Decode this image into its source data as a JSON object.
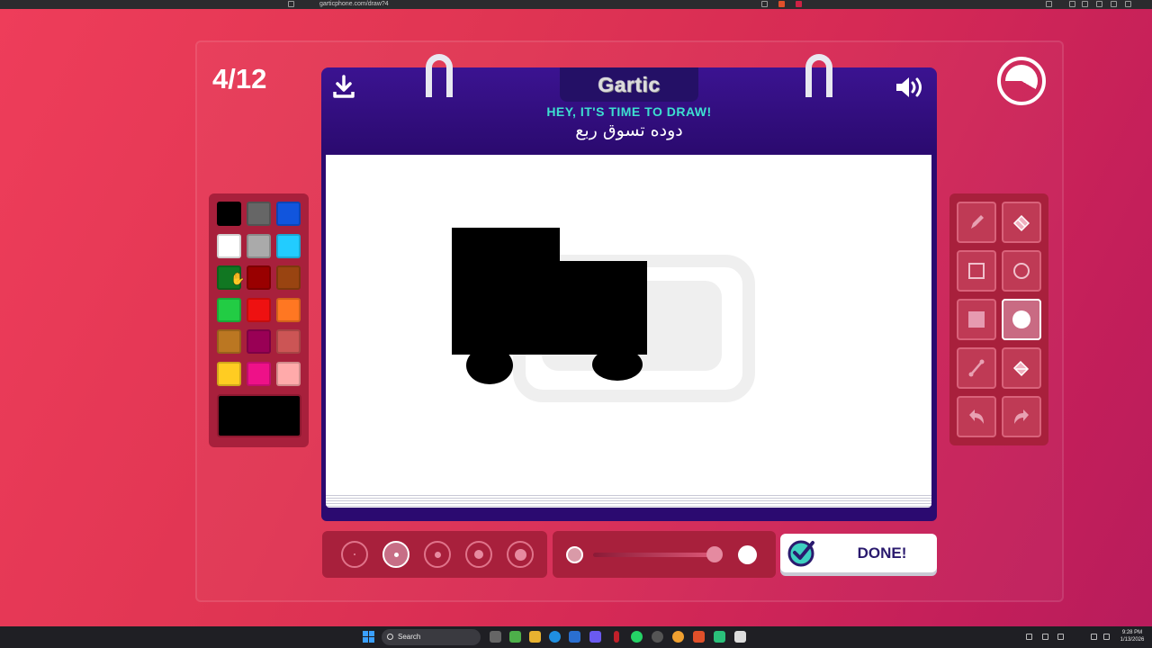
{
  "browser": {
    "url": "garticphone.com/draw?4"
  },
  "game": {
    "round": "4/12",
    "logo": "Gartic",
    "instruction": "HEY, IT'S TIME TO DRAW!",
    "prompt": "دوده تسوق ربع",
    "done_label": "DONE!",
    "selected_color": "#000000",
    "selected_tool": "ellipse-fill",
    "selected_brush_size_index": 1,
    "opacity": 0.95,
    "timer_remaining_fraction": 0.75
  },
  "palette": [
    "#000000",
    "#666666",
    "#1155dd",
    "#ffffff",
    "#aaaaaa",
    "#22ccff",
    "#117722",
    "#990000",
    "#994411",
    "#22cc44",
    "#ee1111",
    "#ff7722",
    "#bb7722",
    "#990055",
    "#cc5555",
    "#ffcc22",
    "#ee1188",
    "#ffaaaa"
  ],
  "tools": [
    "pencil-tool",
    "eraser-tool",
    "rectangle-outline-tool",
    "ellipse-outline-tool",
    "rectangle-fill-tool",
    "ellipse-fill-tool",
    "line-tool",
    "bucket-fill-tool",
    "undo-tool",
    "redo-tool"
  ],
  "brush_sizes": [
    1,
    2,
    3,
    4,
    5
  ],
  "taskbar": {
    "search_placeholder": "Search",
    "time": "9:28 PM",
    "date": "1/13/2026"
  }
}
